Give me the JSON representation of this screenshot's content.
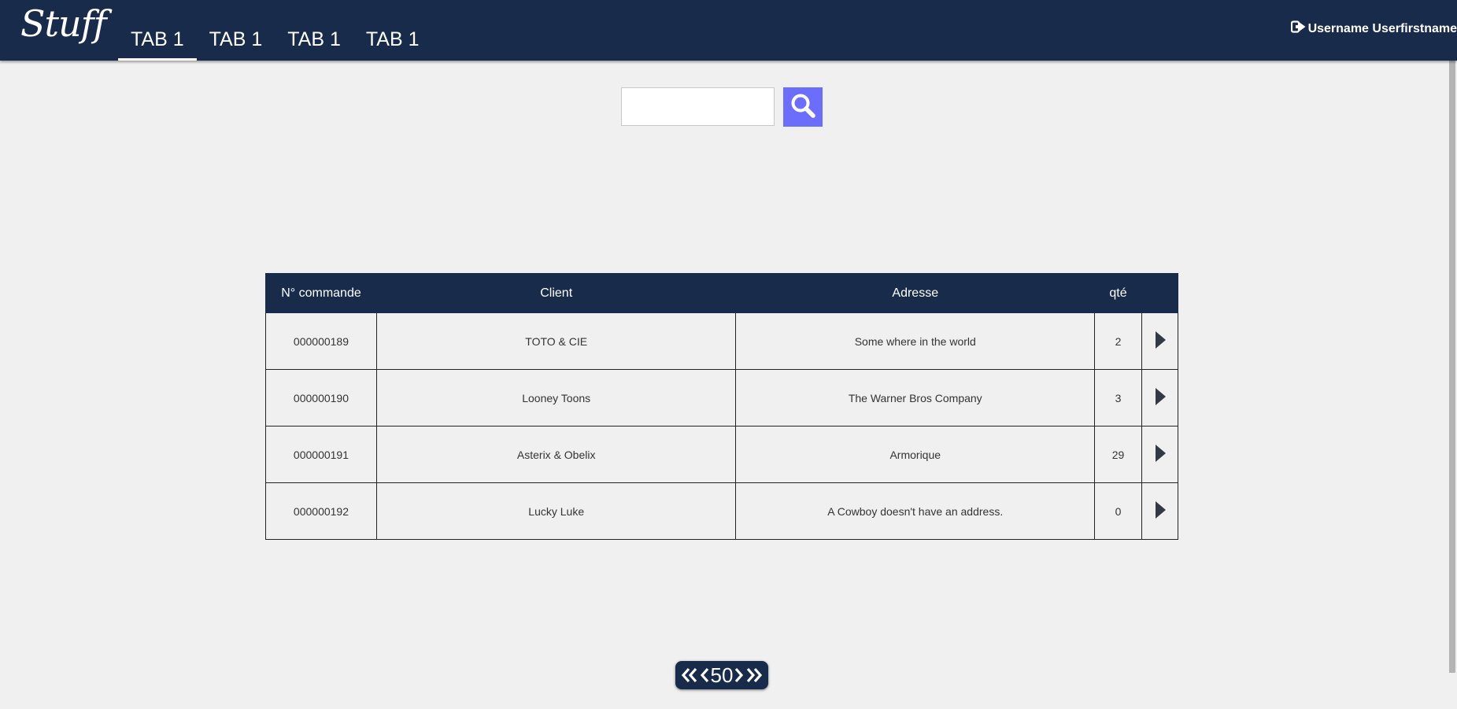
{
  "header": {
    "logo": "Stuff",
    "tabs": [
      {
        "label": "TAB 1",
        "active": true
      },
      {
        "label": "TAB 1",
        "active": false
      },
      {
        "label": "TAB 1",
        "active": false
      },
      {
        "label": "TAB 1",
        "active": false
      }
    ],
    "user_name": "Username Userfirstname",
    "logout_icon": "sign-out-icon"
  },
  "search": {
    "value": "",
    "placeholder": "",
    "button_icon": "search-icon",
    "button_color": "#6d6dfc"
  },
  "table": {
    "columns": [
      "N° commande",
      "Client",
      "Adresse",
      "qté"
    ],
    "rows": [
      {
        "order": "000000189",
        "client": "TOTO & CIE",
        "address": "Some where in the world",
        "qty": "2"
      },
      {
        "order": "000000190",
        "client": "Looney Toons",
        "address": "The Warner Bros Company",
        "qty": "3"
      },
      {
        "order": "000000191",
        "client": "Asterix & Obelix",
        "address": "Armorique",
        "qty": "29"
      },
      {
        "order": "000000192",
        "client": "Lucky Luke",
        "address": "A Cowboy doesn't have an address.",
        "qty": "0"
      }
    ],
    "row_action_icon": "caret-right-icon"
  },
  "pagination": {
    "page_size": "50",
    "icons": [
      "double-chevron-left-icon",
      "chevron-left-icon",
      "chevron-right-icon",
      "double-chevron-right-icon"
    ]
  },
  "colors": {
    "header_bg": "#182b4a",
    "page_bg": "#f0f0f0",
    "accent": "#6d6dfc"
  }
}
